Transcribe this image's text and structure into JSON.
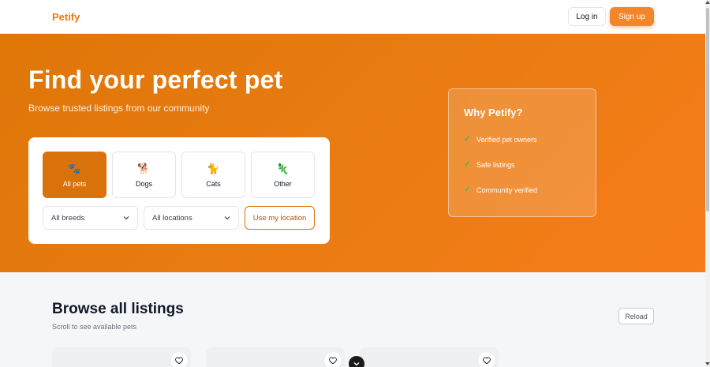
{
  "header": {
    "logo": "Petify",
    "login_label": "Log in",
    "signup_label": "Sign up"
  },
  "hero": {
    "title": "Find your perfect pet",
    "subtitle": "Browse trusted listings from our community",
    "categories": [
      {
        "label": "All pets",
        "icon": "🐾",
        "icon_name": "paw-icon",
        "active": true
      },
      {
        "label": "Dogs",
        "icon": "🐕",
        "icon_name": "dog-icon",
        "active": false
      },
      {
        "label": "Cats",
        "icon": "🐈",
        "icon_name": "cat-icon",
        "active": false
      },
      {
        "label": "Other",
        "icon": "🦎",
        "icon_name": "lizard-icon",
        "active": false
      }
    ],
    "breed_select": "All breeds",
    "location_select": "All locations",
    "use_location_label": "Use my location"
  },
  "why": {
    "title": "Why Petify?",
    "items": [
      "Verified pet owners",
      "Safe listings",
      "Community verified"
    ]
  },
  "browse": {
    "title": "Browse all listings",
    "subtitle": "Scroll to see available pets",
    "reload_label": "Reload"
  },
  "colors": {
    "accent": "#ee7a14",
    "hero_start": "#df7608",
    "hero_end": "#f77c1a",
    "active_tile": "#d9720a",
    "check": "#3fbf4d"
  }
}
